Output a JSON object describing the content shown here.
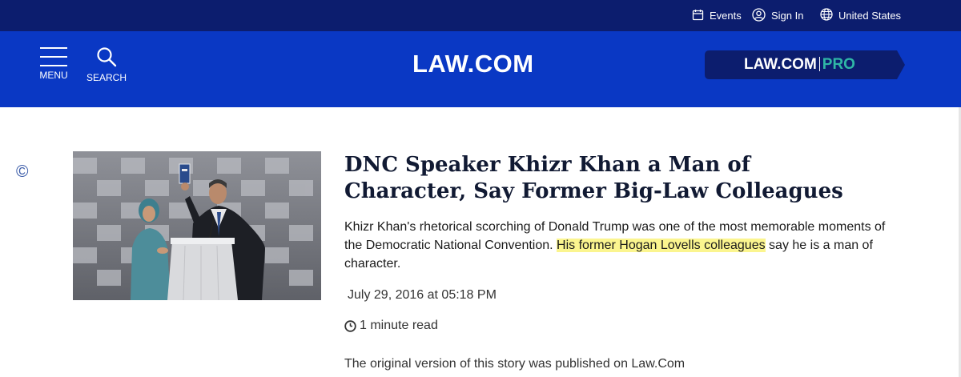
{
  "topbar": {
    "events_label": "Events",
    "signin_label": "Sign In",
    "country_label": "United States",
    "icons": [
      "calendar-icon",
      "user-icon",
      "globe-icon"
    ]
  },
  "header": {
    "menu_label": "MENU",
    "search_label": "SEARCH",
    "logo_text": "LAW.COM",
    "pro_logo_main": "LAW.COM",
    "pro_logo_suffix": "PRO",
    "colors": {
      "topbar_bg": "#0c1d6e",
      "mainbar_bg": "#0a38c4",
      "pro_button_bg": "#0c1d6e",
      "pro_accent": "#2fb7a6"
    }
  },
  "article": {
    "copyright_symbol": "©",
    "headline": "DNC Speaker Khizr Khan a Man of Character, Say Former Big-Law Colleagues",
    "deck_before": "Khizr Khan's rhetorical scorching of Donald Trump was one of the most memorable moments of the Democratic National Convention. ",
    "deck_highlight": "His former Hogan Lovells colleagues",
    "deck_after": " say he is a man of character.",
    "date": "July 29, 2016 at 05:18 PM",
    "read_time": "1 minute read",
    "origin_note": "The original version of this story was published on Law.Com",
    "highlight_color": "#fbf58f"
  }
}
